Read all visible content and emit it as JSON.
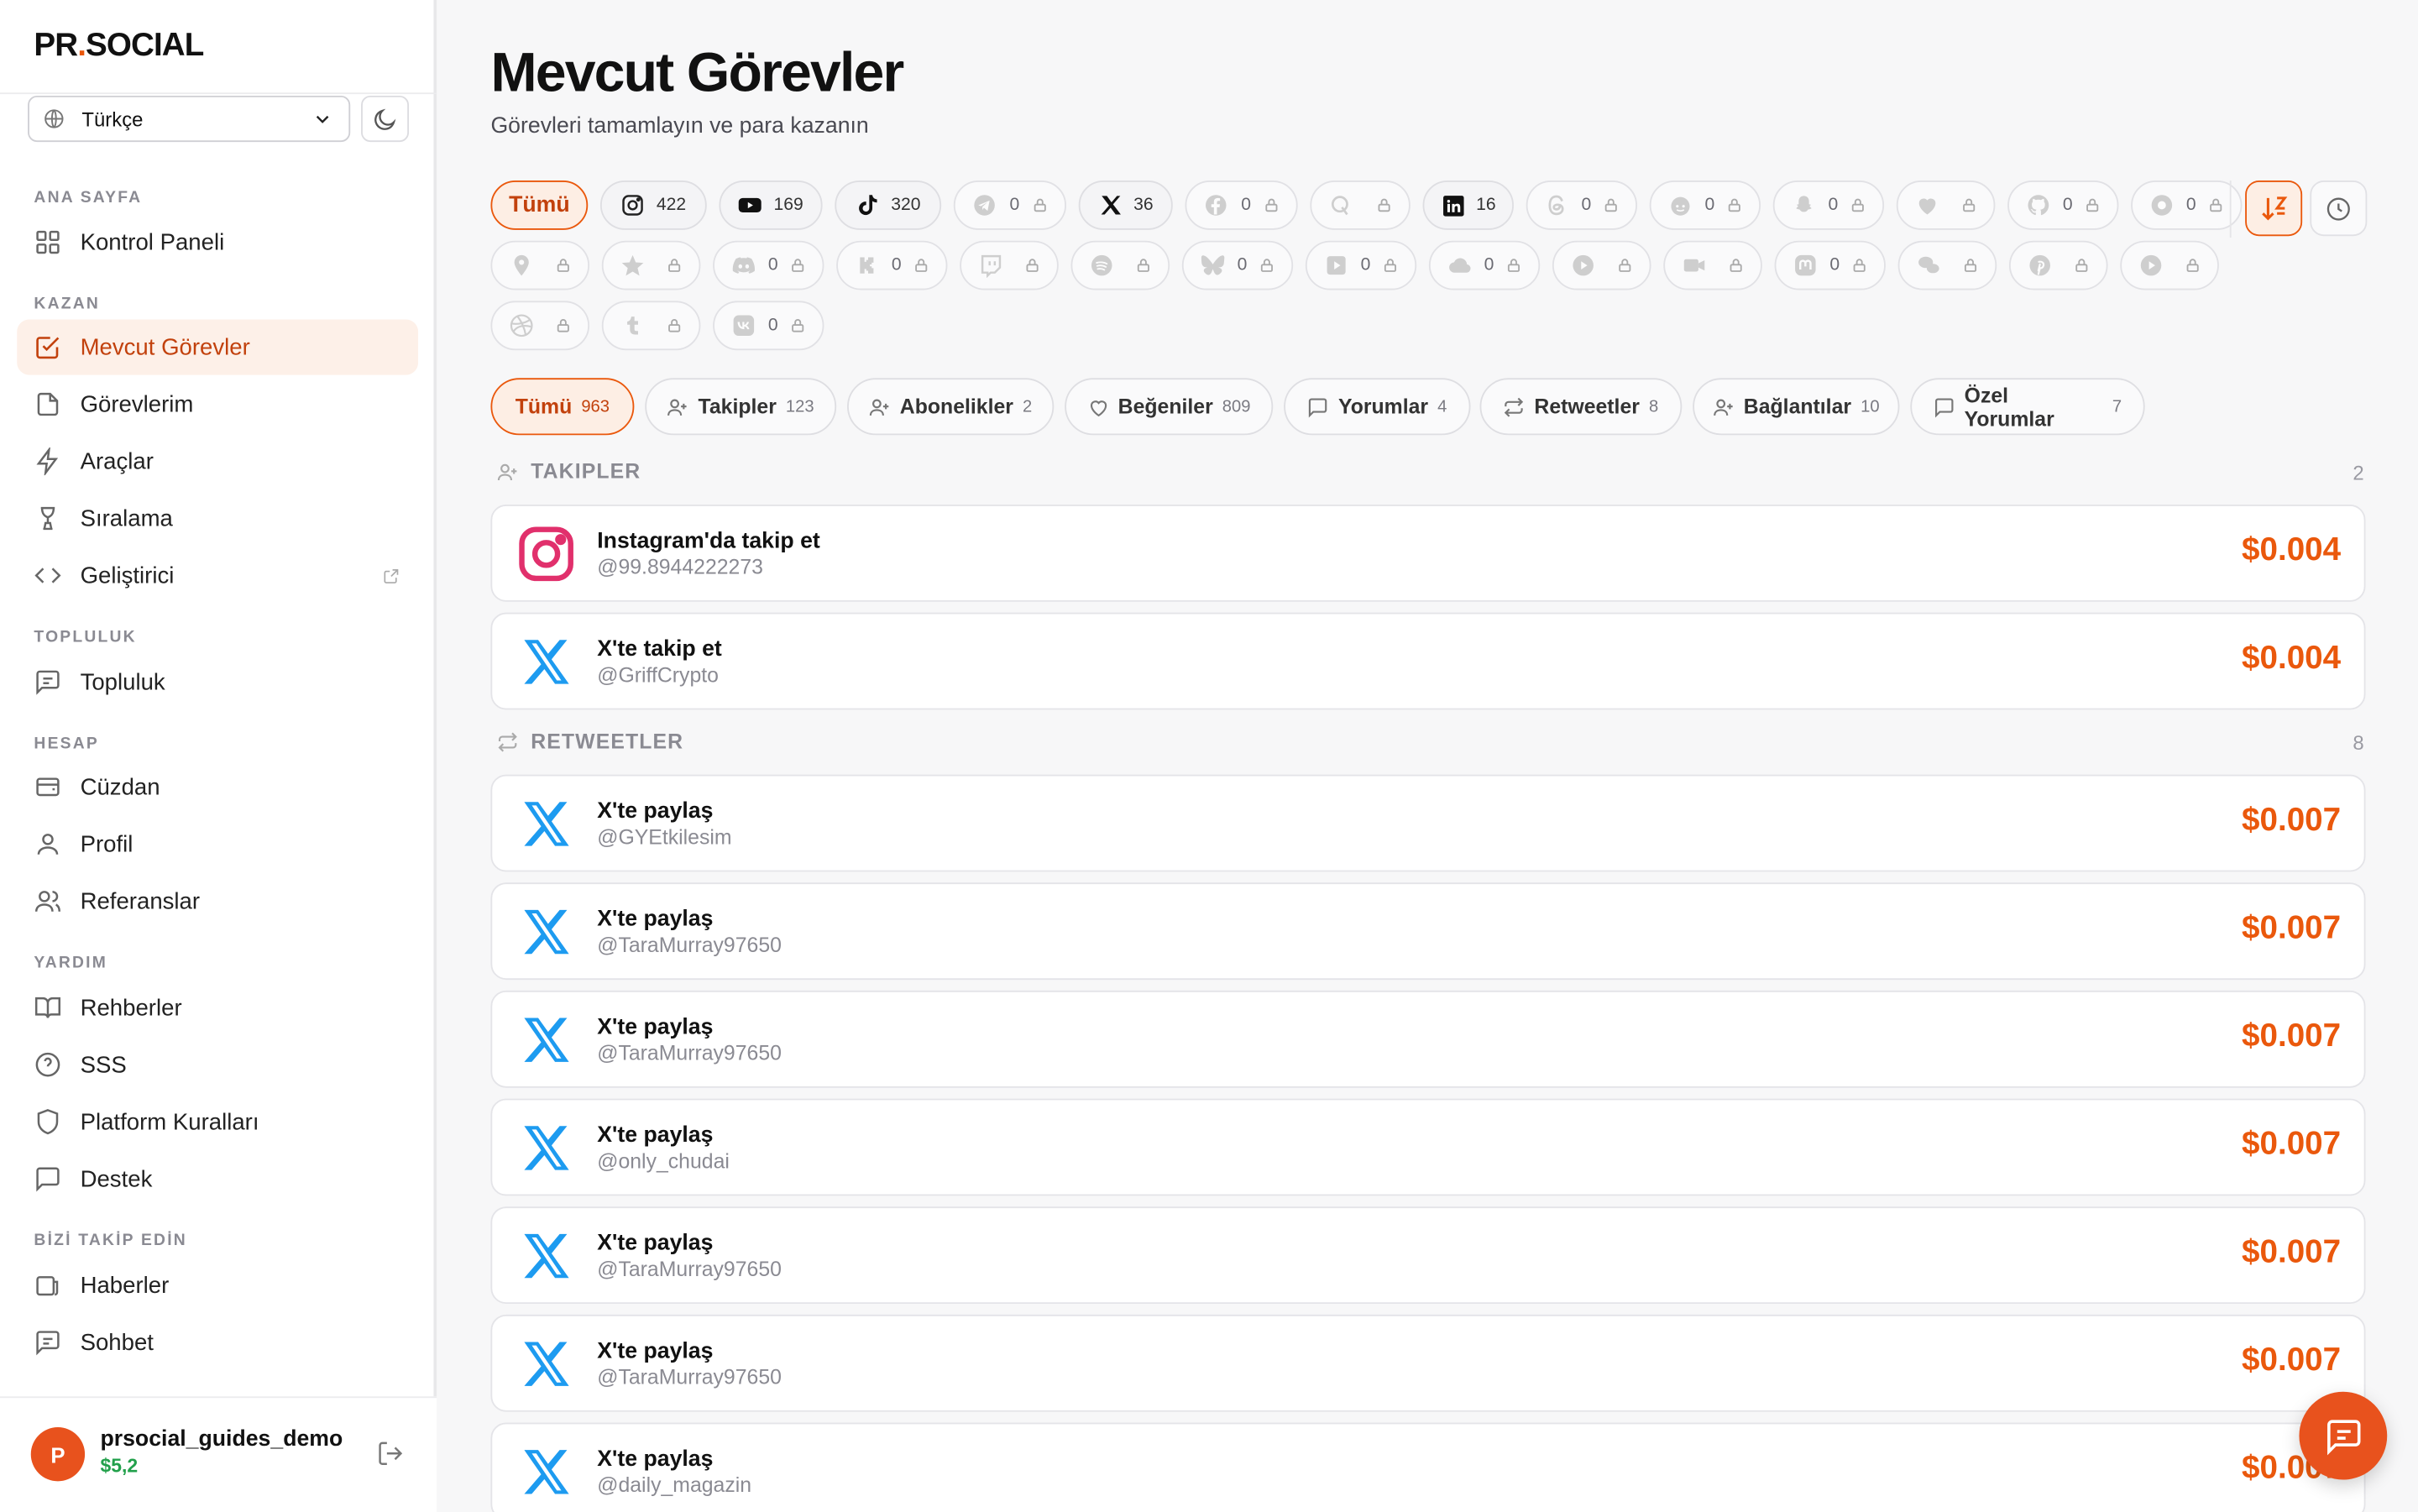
{
  "brand": {
    "part1": "PR",
    "dot": ".",
    "part2": "SOCIAL",
    "accent": "#ea580c"
  },
  "language": {
    "selected": "Türkçe"
  },
  "nav": {
    "sections": [
      {
        "title": "ANA SAYFA",
        "items": [
          {
            "label": "Kontrol Paneli",
            "icon": "grid-icon"
          }
        ]
      },
      {
        "title": "KAZAN",
        "items": [
          {
            "label": "Mevcut Görevler",
            "icon": "checkbox-icon",
            "active": true
          },
          {
            "label": "Görevlerim",
            "icon": "file-icon"
          },
          {
            "label": "Araçlar",
            "icon": "lightning-icon"
          },
          {
            "label": "Sıralama",
            "icon": "trophy-icon"
          },
          {
            "label": "Geliştirici",
            "icon": "code-icon",
            "external": true
          }
        ]
      },
      {
        "title": "TOPLULUK",
        "items": [
          {
            "label": "Topluluk",
            "icon": "message-square-icon"
          }
        ]
      },
      {
        "title": "HESAP",
        "items": [
          {
            "label": "Cüzdan",
            "icon": "wallet-icon"
          },
          {
            "label": "Profil",
            "icon": "user-icon"
          },
          {
            "label": "Referanslar",
            "icon": "users-icon"
          }
        ]
      },
      {
        "title": "YARDIM",
        "items": [
          {
            "label": "Rehberler",
            "icon": "book-icon"
          },
          {
            "label": "SSS",
            "icon": "help-circle-icon"
          },
          {
            "label": "Platform Kuralları",
            "icon": "shield-icon"
          },
          {
            "label": "Destek",
            "icon": "message-icon"
          }
        ]
      },
      {
        "title": "BİZİ TAKİP EDİN",
        "items": [
          {
            "label": "Haberler",
            "icon": "news-icon"
          },
          {
            "label": "Sohbet",
            "icon": "chat-icon"
          }
        ]
      }
    ]
  },
  "user": {
    "initial": "P",
    "name": "prsocial_guides_demo",
    "balance": "$5,2"
  },
  "page": {
    "title": "Mevcut Görevler",
    "subtitle": "Görevleri tamamlayın ve para kazanın"
  },
  "platform_filters": [
    {
      "label": "Tümü",
      "active": true
    },
    {
      "icon": "instagram-icon",
      "count": "422"
    },
    {
      "icon": "youtube-icon",
      "count": "169"
    },
    {
      "icon": "tiktok-icon",
      "count": "320"
    },
    {
      "icon": "telegram-icon",
      "count": "0",
      "locked": true
    },
    {
      "icon": "x-icon",
      "count": "36"
    },
    {
      "icon": "facebook-icon",
      "count": "0",
      "locked": true
    },
    {
      "icon": "quora-icon",
      "count": "",
      "locked": true
    },
    {
      "icon": "linkedin-icon",
      "count": "16"
    },
    {
      "icon": "threads-icon",
      "count": "0",
      "locked": true
    },
    {
      "icon": "reddit-icon",
      "count": "0",
      "locked": true
    },
    {
      "icon": "snapchat-icon",
      "count": "0",
      "locked": true
    },
    {
      "icon": "heart-icon",
      "count": "",
      "locked": true
    },
    {
      "icon": "github-icon",
      "count": "0",
      "locked": true
    },
    {
      "icon": "circle-icon",
      "count": "0",
      "locked": true
    },
    {
      "icon": "map-pin-icon",
      "count": "",
      "locked": true
    },
    {
      "icon": "star-icon",
      "count": "",
      "locked": true
    },
    {
      "icon": "discord-icon",
      "count": "0",
      "locked": true
    },
    {
      "icon": "kick-icon",
      "count": "0",
      "locked": true
    },
    {
      "icon": "twitch-icon",
      "count": "",
      "locked": true
    },
    {
      "icon": "spotify-icon",
      "count": "",
      "locked": true
    },
    {
      "icon": "bluesky-icon",
      "count": "0",
      "locked": true
    },
    {
      "icon": "play-square-icon",
      "count": "0",
      "locked": true
    },
    {
      "icon": "cloud-icon",
      "count": "0",
      "locked": true
    },
    {
      "icon": "play-circle-icon",
      "count": "",
      "locked": true
    },
    {
      "icon": "video-icon",
      "count": "",
      "locked": true
    },
    {
      "icon": "mastodon-icon",
      "count": "0",
      "locked": true
    },
    {
      "icon": "wechat-icon",
      "count": "",
      "locked": true
    },
    {
      "icon": "pinterest-icon",
      "count": "",
      "locked": true
    },
    {
      "icon": "play-icon",
      "count": "",
      "locked": true
    },
    {
      "icon": "dribbble-icon",
      "count": "",
      "locked": true
    },
    {
      "icon": "tumblr-icon",
      "count": "",
      "locked": true
    },
    {
      "icon": "vk-icon",
      "count": "0",
      "locked": true
    }
  ],
  "category_filters": [
    {
      "label": "Tümü",
      "count": "963",
      "active": true
    },
    {
      "label": "Takipler",
      "count": "123",
      "icon": "user-plus-icon"
    },
    {
      "label": "Abonelikler",
      "count": "2",
      "icon": "user-plus-icon"
    },
    {
      "label": "Beğeniler",
      "count": "809",
      "icon": "heart-icon"
    },
    {
      "label": "Yorumlar",
      "count": "4",
      "icon": "comment-icon"
    },
    {
      "label": "Retweetler",
      "count": "8",
      "icon": "repeat-icon"
    },
    {
      "label": "Bağlantılar",
      "count": "10",
      "icon": "user-plus-icon"
    },
    {
      "label": "Özel Yorumlar",
      "count": "7",
      "icon": "comment-icon"
    }
  ],
  "groups": [
    {
      "title": "TAKIPLER",
      "count": "2",
      "icon": "user-plus-icon",
      "tasks": [
        {
          "platform": "instagram-icon",
          "title": "Instagram'da takip et",
          "handle": "@99.8944222273",
          "price": "$0.004"
        },
        {
          "platform": "x-icon",
          "title": "X'te takip et",
          "handle": "@GriffCrypto",
          "price": "$0.004"
        }
      ]
    },
    {
      "title": "RETWEETLER",
      "count": "8",
      "icon": "repeat-icon",
      "tasks": [
        {
          "platform": "x-icon",
          "title": "X'te paylaş",
          "handle": "@GYEtkilesim",
          "price": "$0.007"
        },
        {
          "platform": "x-icon",
          "title": "X'te paylaş",
          "handle": "@TaraMurray97650",
          "price": "$0.007"
        },
        {
          "platform": "x-icon",
          "title": "X'te paylaş",
          "handle": "@TaraMurray97650",
          "price": "$0.007"
        },
        {
          "platform": "x-icon",
          "title": "X'te paylaş",
          "handle": "@only_chudai",
          "price": "$0.007"
        },
        {
          "platform": "x-icon",
          "title": "X'te paylaş",
          "handle": "@TaraMurray97650",
          "price": "$0.007"
        },
        {
          "platform": "x-icon",
          "title": "X'te paylaş",
          "handle": "@TaraMurray97650",
          "price": "$0.007"
        },
        {
          "platform": "x-icon",
          "title": "X'te paylaş",
          "handle": "@daily_magazin",
          "price": "$0.007"
        }
      ]
    }
  ],
  "colors": {
    "accent": "#ea580c",
    "x_blue": "#1d9bf0",
    "instagram": "#e1306c",
    "balance": "#22a04b"
  }
}
